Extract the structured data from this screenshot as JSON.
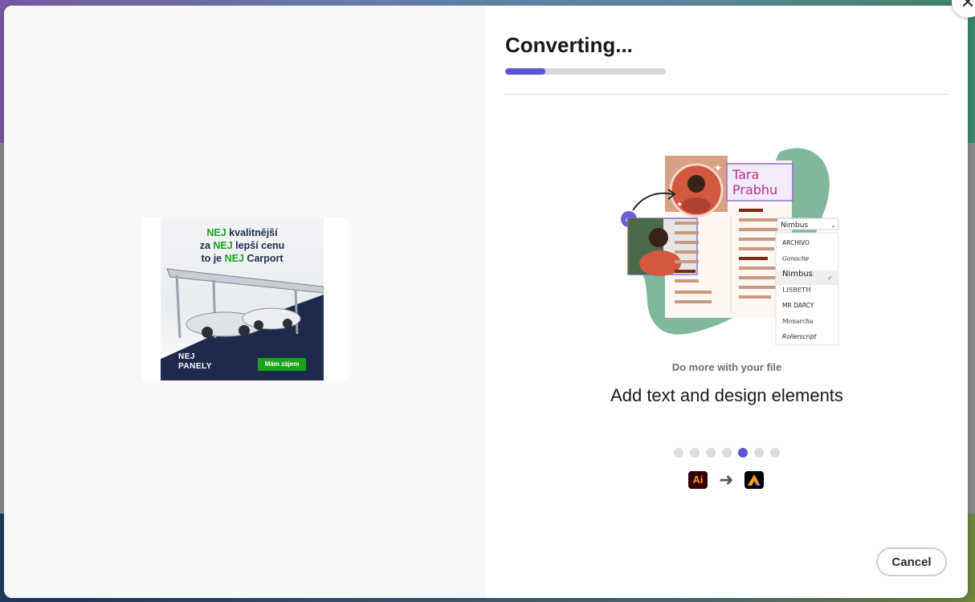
{
  "dialog": {
    "title": "Converting...",
    "progress_percent": 25,
    "tagline": "Do more with your file",
    "headline": "Add text and design elements",
    "cancel_label": "Cancel",
    "carousel": {
      "count": 7,
      "active_index": 4
    },
    "source_app_label": "Ai",
    "source_app_icon": "illustrator-app-icon",
    "arrow_icon": "arrow-right-icon",
    "target_app_icon": "adobe-express-app-icon",
    "close_icon": "close-icon",
    "accent_color": "#5a55d6"
  },
  "illustration": {
    "name_line1": "Tara",
    "name_line2": "Prabhu",
    "font_selector": "Nimbus",
    "fonts": [
      "ARCHIVO",
      "Ganache",
      "Nimbus",
      "LISBETH",
      "MR DARCY",
      "Monarcha",
      "Rollerscript"
    ],
    "selected_font": "Nimbus"
  },
  "preview_ad": {
    "line1_highlight": "NEJ",
    "line1_rest": " kvalitnější",
    "line2_prefix": "za ",
    "line2_highlight": "NEJ",
    "line2_rest": " lepší cenu",
    "line3_prefix": "to je ",
    "line3_highlight": "NEJ",
    "line3_rest": " Carport",
    "logo_line1": "NEJ",
    "logo_line2": "PANELY",
    "cta": "Mám zájem",
    "brand_green": "#19a319",
    "brand_navy": "#1d2a4c"
  }
}
